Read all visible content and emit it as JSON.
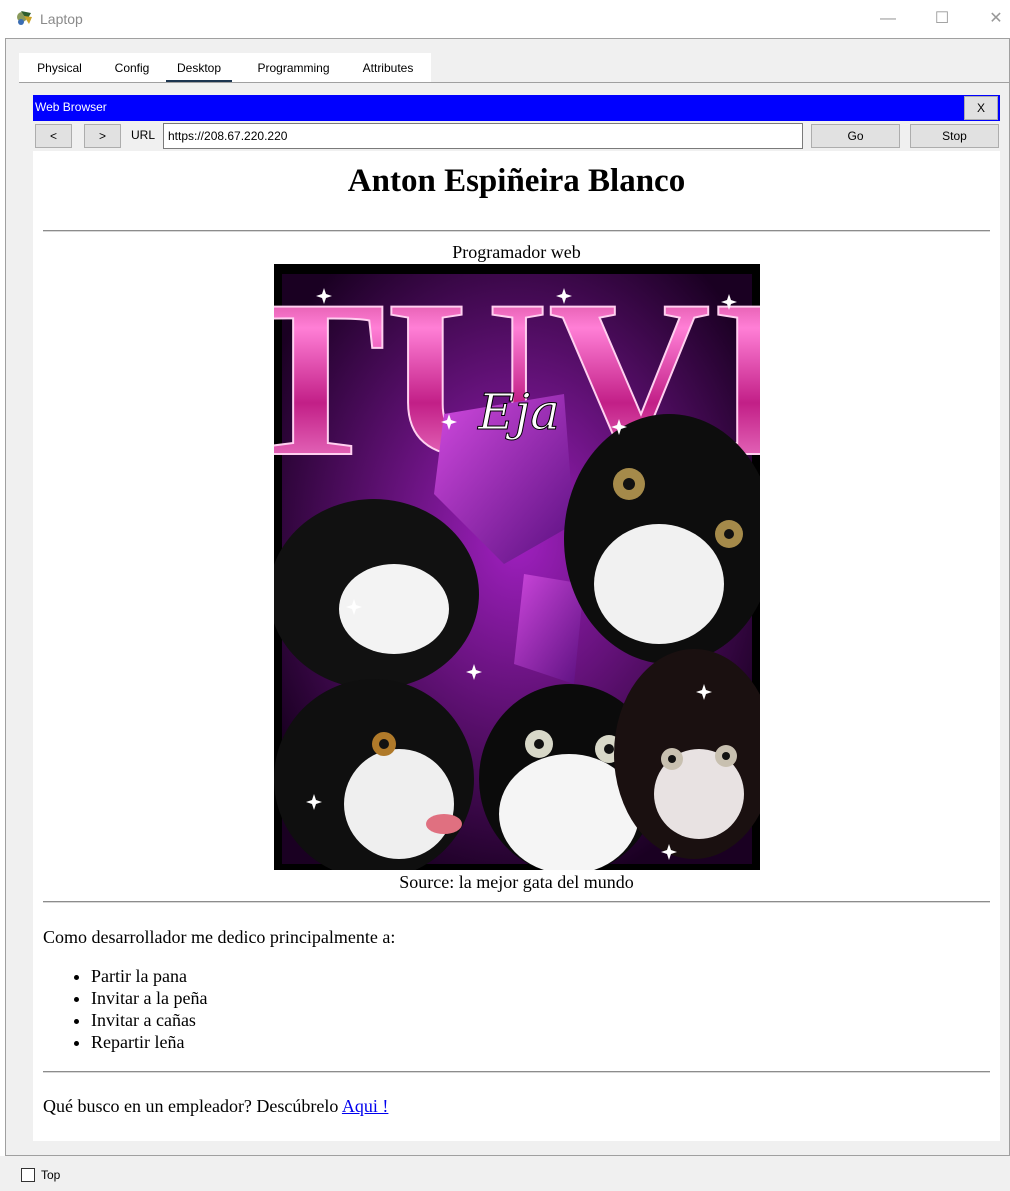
{
  "window": {
    "title": "Laptop",
    "minimize": "—",
    "maximize": "☐",
    "close": "✕"
  },
  "tabs": [
    "Physical",
    "Config",
    "Desktop",
    "Programming",
    "Attributes"
  ],
  "active_tab": "Desktop",
  "browser": {
    "title": "Web Browser",
    "close_label": "X",
    "back_label": "<",
    "forward_label": ">",
    "url_label": "URL",
    "url_value": "https://208.67.220.220",
    "go_label": "Go",
    "stop_label": "Stop"
  },
  "page": {
    "heading": "Anton Espiñeira Blanco",
    "subtitle": "Programador web",
    "image_caption": "Source: la mejor gata del mundo",
    "poster_title": "TUVI",
    "poster_signature": "Eja",
    "intro": "Como desarrollador me dedico principalmente a:",
    "skills": [
      "Partir la pana",
      "Invitar a la peña",
      "Invitar a cañas",
      "Repartir leña"
    ],
    "cta_text": "Qué busco en un empleador? Descúbrelo ",
    "cta_link": "Aqui !"
  },
  "footer": {
    "top_label": "Top",
    "top_checked": false
  },
  "colors": {
    "browser_titlebar": "#0000ff",
    "tab_active_underline": "#1c3550",
    "link": "#0000ee",
    "poster_magenta": "#e040c0"
  }
}
